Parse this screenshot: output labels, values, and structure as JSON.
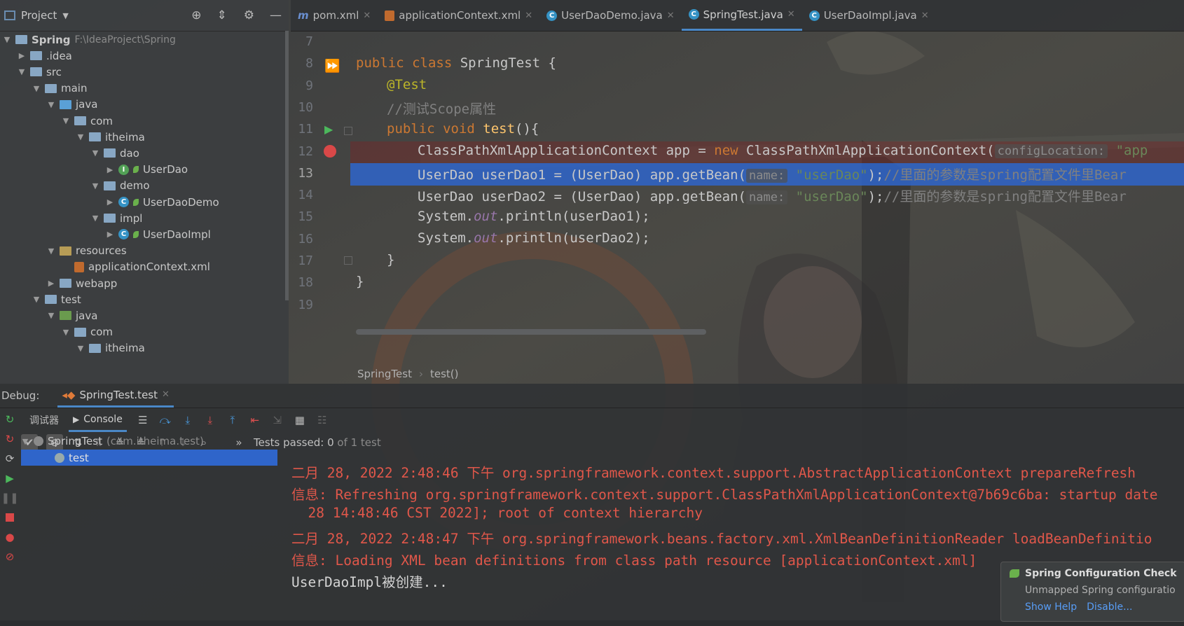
{
  "project": {
    "header_label": "Project",
    "tree": [
      {
        "label": "Spring",
        "extra": "F:\\IdeaProject\\Spring",
        "kind": "module"
      },
      {
        "label": ".idea",
        "kind": "folder"
      },
      {
        "label": "src",
        "kind": "folder"
      },
      {
        "label": "main",
        "kind": "folder"
      },
      {
        "label": "java",
        "kind": "src"
      },
      {
        "label": "com",
        "kind": "pkg"
      },
      {
        "label": "itheima",
        "kind": "pkg"
      },
      {
        "label": "dao",
        "kind": "pkg"
      },
      {
        "label": "UserDao",
        "kind": "interface"
      },
      {
        "label": "demo",
        "kind": "pkg"
      },
      {
        "label": "UserDaoDemo",
        "kind": "class-run"
      },
      {
        "label": "impl",
        "kind": "pkg"
      },
      {
        "label": "UserDaoImpl",
        "kind": "class"
      },
      {
        "label": "resources",
        "kind": "res"
      },
      {
        "label": "applicationContext.xml",
        "kind": "xml"
      },
      {
        "label": "webapp",
        "kind": "folder"
      },
      {
        "label": "test",
        "kind": "folder"
      },
      {
        "label": "java",
        "kind": "test"
      },
      {
        "label": "com",
        "kind": "pkg"
      },
      {
        "label": "itheima",
        "kind": "pkg"
      }
    ]
  },
  "editor": {
    "tabs": [
      {
        "label": "pom.xml",
        "icon": "maven-icon"
      },
      {
        "label": "applicationContext.xml",
        "icon": "xml-icon"
      },
      {
        "label": "UserDaoDemo.java",
        "icon": "class-icon"
      },
      {
        "label": "SpringTest.java",
        "icon": "class-icon",
        "active": true
      },
      {
        "label": "UserDaoImpl.java",
        "icon": "class-icon"
      }
    ],
    "line_numbers": [
      "7",
      "8",
      "9",
      "10",
      "11",
      "12",
      "13",
      "14",
      "15",
      "16",
      "17",
      "18",
      "19"
    ],
    "code": {
      "l8_kw": "public class ",
      "l8_rest": "SpringTest {",
      "l9": "@Test",
      "l10": "//测试Scope属性",
      "l11_kw": "public void ",
      "l11_fn": "test",
      "l11_rest": "(){",
      "l12_a": "ClassPathXmlApplicationContext app = ",
      "l12_kw": "new ",
      "l12_b": "ClassPathXmlApplicationContext(",
      "l12_hint": "configLocation:",
      "l12_str": "\"app",
      "l13_a": "UserDao userDao1 = (UserDao) app.getBean(",
      "l13_hint": "name:",
      "l13_str": "\"userDao\"",
      "l13_b": ");",
      "l13_cm": "//里面的参数是spring配置文件里Bear",
      "l14_a": "UserDao userDao2 = (UserDao) app.getBean(",
      "l14_hint": "name:",
      "l14_str": "\"userDao\"",
      "l14_b": ");",
      "l14_cm": "//里面的参数是spring配置文件里Bear",
      "l15_a": "System.",
      "l15_f": "out",
      "l15_b": ".println(userDao1);",
      "l16_a": "System.",
      "l16_f": "out",
      "l16_b": ".println(userDao2);",
      "l17": "}",
      "l18": "}"
    },
    "breadcrumb": [
      "SpringTest",
      "test()"
    ]
  },
  "debug": {
    "label": "Debug:",
    "session_tab": "SpringTest.test",
    "debugger_tab": "调试器",
    "console_tab": "Console",
    "tests_passed_label": "Tests passed:",
    "tests_passed_value": "0",
    "tests_passed_suffix": "of 1 test",
    "test_tree": [
      {
        "label": "SpringTest",
        "extra": "(com.itheima.test)"
      },
      {
        "label": "test"
      }
    ],
    "console_lines": [
      "二月 28, 2022 2:48:46 下午 org.springframework.context.support.AbstractApplicationContext prepareRefresh",
      "信息: Refreshing org.springframework.context.support.ClassPathXmlApplicationContext@7b69c6ba: startup date",
      "  28 14:48:46 CST 2022]; root of context hierarchy",
      "二月 28, 2022 2:48:47 下午 org.springframework.beans.factory.xml.XmlBeanDefinitionReader loadBeanDefinitio",
      "信息: Loading XML bean definitions from class path resource [applicationContext.xml]",
      "UserDaoImpl被创建..."
    ]
  },
  "notification": {
    "title": "Spring Configuration Check",
    "body": "Unmapped Spring configuratio",
    "link1": "Show Help",
    "link2": "Disable..."
  },
  "colors": {
    "accent": "#4a88c7",
    "selection": "#2f65ca",
    "error_text": "#e0574a",
    "keyword": "#cc7832"
  }
}
